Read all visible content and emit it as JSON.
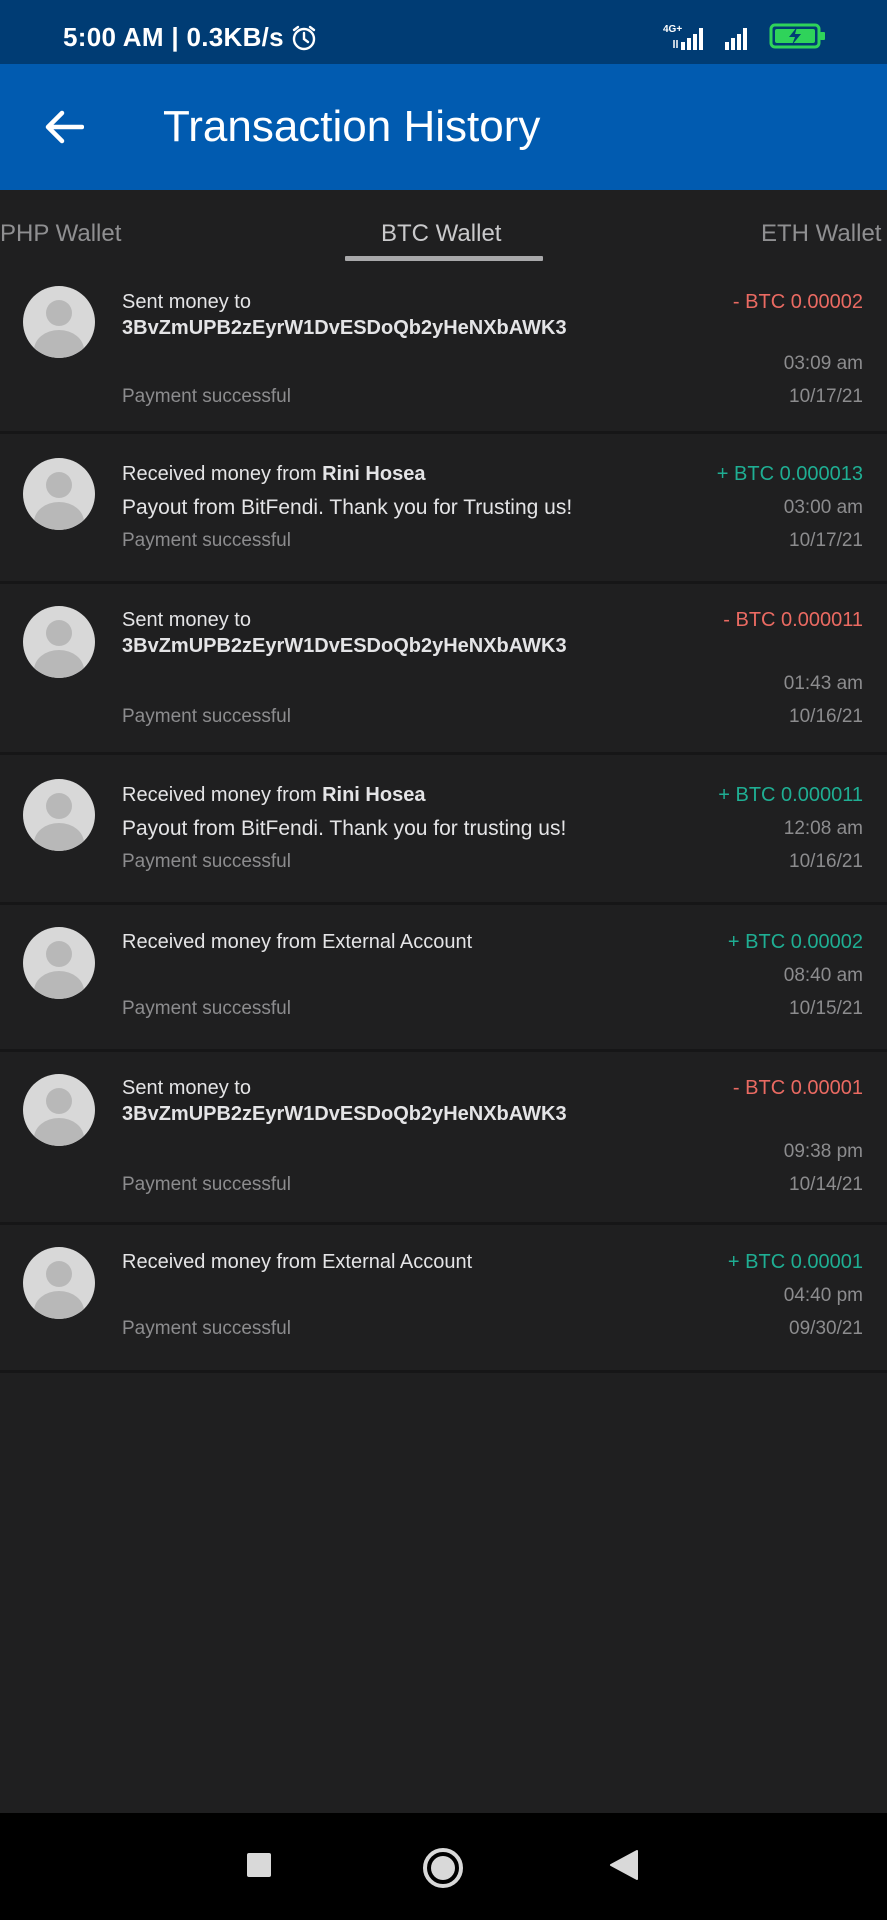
{
  "status_bar": {
    "time": "5:00 AM | 0.3KB/s",
    "network": "4G+",
    "icons": [
      "alarm-icon",
      "signal-icon",
      "signal-icon",
      "battery-charging-icon"
    ],
    "battery_color": "#2fd35a"
  },
  "header": {
    "title": "Transaction History",
    "background": "#015bb0"
  },
  "tabs": [
    {
      "label": "PHP Wallet",
      "active": false
    },
    {
      "label": "BTC Wallet",
      "active": true
    },
    {
      "label": "ETH Wallet",
      "active": false
    }
  ],
  "transactions": [
    {
      "type": "sent",
      "title": "Sent money to",
      "address": "3BvZmUPB2zEyrW1DvESDoQb2yHeNXbAWK3",
      "amount": "- BTC 0.00002",
      "time": "03:09 am",
      "date": "10/17/21",
      "status": "Payment successful"
    },
    {
      "type": "received",
      "title_prefix": "Received money from",
      "sender": "Rini Hosea",
      "memo": "Payout from BitFendi. Thank you for Trusting us!",
      "amount": "+ BTC 0.000013",
      "time": "03:00 am",
      "date": "10/17/21",
      "status": "Payment successful"
    },
    {
      "type": "sent",
      "title": "Sent money to",
      "address": "3BvZmUPB2zEyrW1DvESDoQb2yHeNXbAWK3",
      "amount": "- BTC 0.000011",
      "time": "01:43 am",
      "date": "10/16/21",
      "status": "Payment successful"
    },
    {
      "type": "received",
      "title_prefix": "Received money from",
      "sender": "Rini Hosea",
      "memo": "Payout from BitFendi. Thank you for trusting us!",
      "amount": "+ BTC 0.000011",
      "time": "12:08 am",
      "date": "10/16/21",
      "status": "Payment successful"
    },
    {
      "type": "external",
      "title": "Received money from External Account",
      "amount": "+ BTC 0.00002",
      "time": "08:40 am",
      "date": "10/15/21",
      "status": "Payment successful"
    },
    {
      "type": "sent",
      "title": "Sent money to",
      "address": "3BvZmUPB2zEyrW1DvESDoQb2yHeNXbAWK3",
      "amount": "- BTC 0.00001",
      "time": "09:38 pm",
      "date": "10/14/21",
      "status": "Payment successful"
    },
    {
      "type": "external",
      "title": "Received money from External Account",
      "amount": "+ BTC 0.00001",
      "time": "04:40 pm",
      "date": "09/30/21",
      "status": "Payment successful"
    }
  ],
  "colors": {
    "negative": "#ea6a62",
    "positive": "#1fae93",
    "background": "#1f1f20"
  },
  "nav_bar": {
    "buttons": [
      "recents-icon",
      "home-icon",
      "back-triangle-icon"
    ]
  }
}
